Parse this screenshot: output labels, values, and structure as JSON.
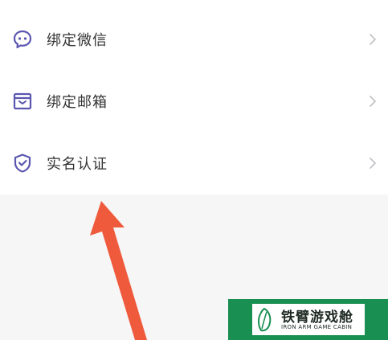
{
  "menu": {
    "items": [
      {
        "label": "绑定微信",
        "icon": "wechat-chat-bubble-icon"
      },
      {
        "label": "绑定邮箱",
        "icon": "mail-box-icon"
      },
      {
        "label": "实名认证",
        "icon": "shield-check-icon"
      }
    ]
  },
  "colors": {
    "icon_accent": "#5b56b0",
    "chevron": "#c4c4c8",
    "arrow": "#ef5a3c",
    "watermark_bg": "#1a8f52"
  },
  "watermark": {
    "title": "铁臂游戏舱",
    "subtitle": "IRON ARM GAME CABIN"
  }
}
